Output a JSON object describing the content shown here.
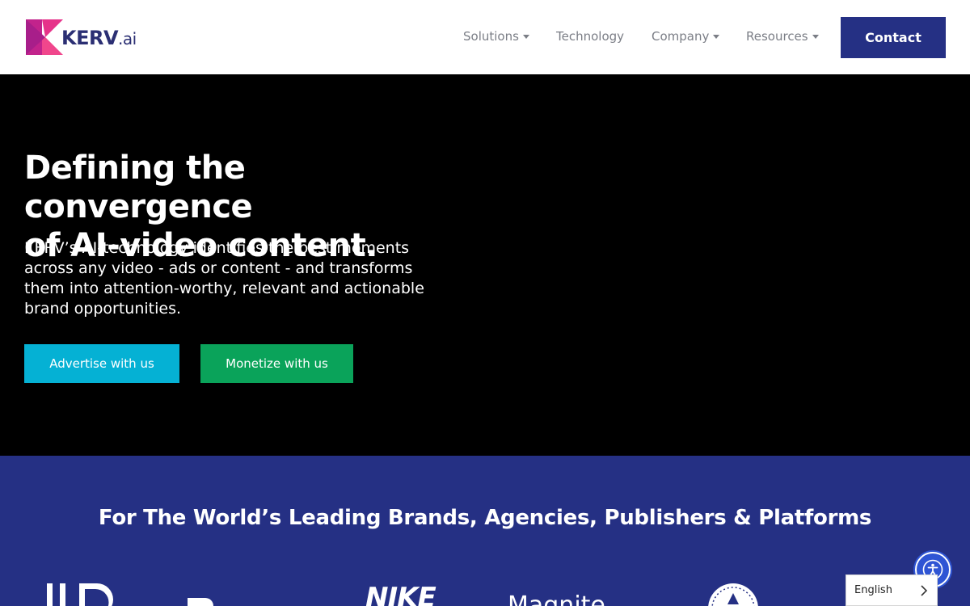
{
  "brand": {
    "name": "KERV",
    "suffix": ".ai"
  },
  "nav": {
    "items": [
      {
        "label": "Solutions",
        "dropdown": true
      },
      {
        "label": "Technology",
        "dropdown": false
      },
      {
        "label": "Company",
        "dropdown": true
      },
      {
        "label": "Resources",
        "dropdown": true
      }
    ],
    "contact_label": "Contact"
  },
  "hero": {
    "title_line1": "Defining the convergence",
    "title_line2": "of AI-video content.",
    "text_line1": "KERV’s AI-technology identifies the best moments",
    "text_line2": "across any video - ads or content - and transforms",
    "text_line3": "them into attention-worthy, relevant and actionable",
    "text_line4": "brand opportunities.",
    "advertise_label": "Advertise with us",
    "monetize_label": "Monetize with us"
  },
  "brands": {
    "title": "For The World’s Leading Brands, Agencies, Publishers & Platforms",
    "logos": [
      "NIKE",
      "Magnite"
    ]
  },
  "widgets": {
    "language": "English"
  },
  "colors": {
    "navy": "#253084",
    "cyan": "#05b1d4",
    "green": "#0aa35a",
    "magenta": "#d6247a"
  },
  "icons": {
    "accessibility": "accessibility-icon",
    "language_chevron": "chevron-right-icon"
  }
}
